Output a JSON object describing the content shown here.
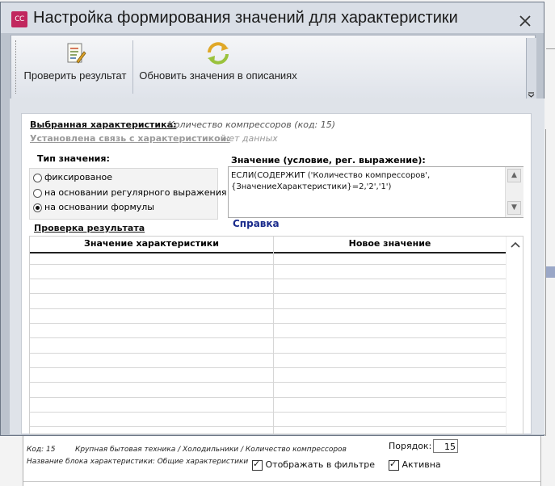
{
  "dialog": {
    "title": "Настройка формирования значений для характеристики",
    "icon_text": "CC"
  },
  "ribbon": {
    "check_label": "Проверить результат",
    "refresh_label": "Обновить значения в описаниях"
  },
  "characteristic": {
    "selected_label": "Выбранная характеристика:",
    "selected_value": "Количество компрессоров (код: 15)",
    "link_label": "Установлена связь с характеристикой:",
    "link_value": "нет данных"
  },
  "value_type": {
    "title": "Тип значения:",
    "options": [
      "фиксированое",
      "на основании регулярного выражения",
      "на основании формулы"
    ],
    "selected": "на основании формулы"
  },
  "formula": {
    "title": "Значение (условие, рег. выражение):",
    "text": "ЕСЛИ(СОДЕРЖИТ ('Количество компрессоров',{ЗначениеХарактеристики}=2,'2','1')"
  },
  "help_label": "Справка",
  "result_check": {
    "title": "Проверка результата",
    "columns": [
      "Значение характеристики",
      "Новое значение"
    ],
    "rows": []
  },
  "background": {
    "code": "Код: 15",
    "path": "Крупная бытовая техника / Холодильники / Количество компрессоров",
    "block_name": "Название блока характеристики: Общие характеристики",
    "order_label": "Порядок:",
    "order_value": "15",
    "show_in_filter": "Отображать в фильтре",
    "active": "Активна"
  }
}
